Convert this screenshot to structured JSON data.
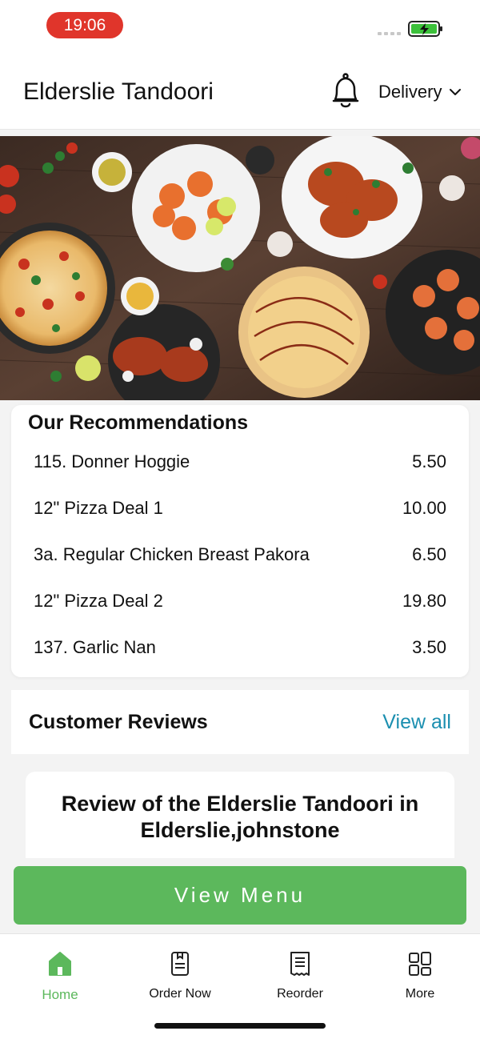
{
  "status_bar": {
    "time": "19:06"
  },
  "header": {
    "title": "Elderslie Tandoori",
    "mode_label": "Delivery"
  },
  "recommendations": {
    "title": "Our Recommendations",
    "items": [
      {
        "name": "115. Donner Hoggie",
        "price": "5.50"
      },
      {
        "name": "12\" Pizza Deal 1",
        "price": "10.00"
      },
      {
        "name": "3a. Regular Chicken Breast Pakora",
        "price": "6.50"
      },
      {
        "name": "12\" Pizza Deal 2",
        "price": "19.80"
      },
      {
        "name": "137. Garlic Nan",
        "price": "3.50"
      }
    ]
  },
  "reviews": {
    "title": "Customer Reviews",
    "view_all_label": "View all",
    "card_text": "Review of the Elderslie Tandoori in Elderslie,johnstone"
  },
  "cta": {
    "view_menu_label": "View Menu"
  },
  "nav": {
    "items": [
      {
        "label": "Home",
        "icon": "home-icon",
        "active": true
      },
      {
        "label": "Order Now",
        "icon": "order-icon",
        "active": false
      },
      {
        "label": "Reorder",
        "icon": "receipt-icon",
        "active": false
      },
      {
        "label": "More",
        "icon": "grid-icon",
        "active": false
      }
    ]
  },
  "colors": {
    "accent_green": "#5cb85c",
    "link_blue": "#1b8fb0",
    "time_pill_red": "#e0352b"
  }
}
